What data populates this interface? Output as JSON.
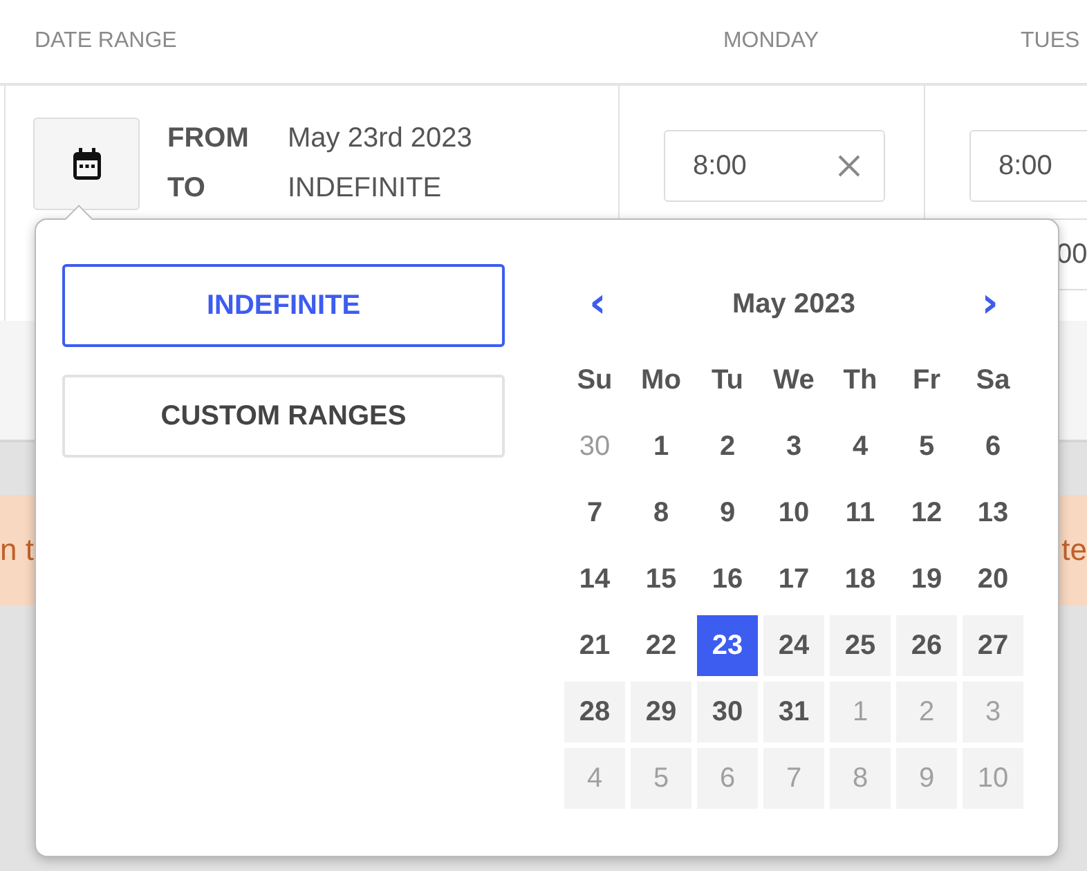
{
  "table": {
    "columns": [
      "DATE RANGE",
      "MONDAY",
      "TUES"
    ],
    "row": {
      "from_label": "FROM",
      "from_value": "May 23rd 2023",
      "to_label": "TO",
      "to_value": "INDEFINITE",
      "monday": {
        "value": "8:00"
      },
      "tuesday": {
        "value": "8:00",
        "second_value": "00"
      }
    }
  },
  "banner": {
    "left_text": "n t",
    "right_text": "te"
  },
  "date_picker": {
    "options": [
      {
        "label": "INDEFINITE",
        "selected": true
      },
      {
        "label": "CUSTOM RANGES",
        "selected": false
      }
    ],
    "prev": "‹",
    "next": "›",
    "month": "May 2023",
    "weekdays": [
      "Su",
      "Mo",
      "Tu",
      "We",
      "Th",
      "Fr",
      "Sa"
    ],
    "days": [
      {
        "label": "30",
        "muted": true,
        "in_range": false,
        "selected": false
      },
      {
        "label": "1",
        "muted": false,
        "in_range": false,
        "selected": false
      },
      {
        "label": "2",
        "muted": false,
        "in_range": false,
        "selected": false
      },
      {
        "label": "3",
        "muted": false,
        "in_range": false,
        "selected": false
      },
      {
        "label": "4",
        "muted": false,
        "in_range": false,
        "selected": false
      },
      {
        "label": "5",
        "muted": false,
        "in_range": false,
        "selected": false
      },
      {
        "label": "6",
        "muted": false,
        "in_range": false,
        "selected": false
      },
      {
        "label": "7",
        "muted": false,
        "in_range": false,
        "selected": false
      },
      {
        "label": "8",
        "muted": false,
        "in_range": false,
        "selected": false
      },
      {
        "label": "9",
        "muted": false,
        "in_range": false,
        "selected": false
      },
      {
        "label": "10",
        "muted": false,
        "in_range": false,
        "selected": false
      },
      {
        "label": "11",
        "muted": false,
        "in_range": false,
        "selected": false
      },
      {
        "label": "12",
        "muted": false,
        "in_range": false,
        "selected": false
      },
      {
        "label": "13",
        "muted": false,
        "in_range": false,
        "selected": false
      },
      {
        "label": "14",
        "muted": false,
        "in_range": false,
        "selected": false
      },
      {
        "label": "15",
        "muted": false,
        "in_range": false,
        "selected": false
      },
      {
        "label": "16",
        "muted": false,
        "in_range": false,
        "selected": false
      },
      {
        "label": "17",
        "muted": false,
        "in_range": false,
        "selected": false
      },
      {
        "label": "18",
        "muted": false,
        "in_range": false,
        "selected": false
      },
      {
        "label": "19",
        "muted": false,
        "in_range": false,
        "selected": false
      },
      {
        "label": "20",
        "muted": false,
        "in_range": false,
        "selected": false
      },
      {
        "label": "21",
        "muted": false,
        "in_range": false,
        "selected": false
      },
      {
        "label": "22",
        "muted": false,
        "in_range": false,
        "selected": false
      },
      {
        "label": "23",
        "muted": false,
        "in_range": true,
        "selected": true
      },
      {
        "label": "24",
        "muted": false,
        "in_range": true,
        "selected": false
      },
      {
        "label": "25",
        "muted": false,
        "in_range": true,
        "selected": false
      },
      {
        "label": "26",
        "muted": false,
        "in_range": true,
        "selected": false
      },
      {
        "label": "27",
        "muted": false,
        "in_range": true,
        "selected": false
      },
      {
        "label": "28",
        "muted": false,
        "in_range": true,
        "selected": false
      },
      {
        "label": "29",
        "muted": false,
        "in_range": true,
        "selected": false
      },
      {
        "label": "30",
        "muted": false,
        "in_range": true,
        "selected": false
      },
      {
        "label": "31",
        "muted": false,
        "in_range": true,
        "selected": false
      },
      {
        "label": "1",
        "muted": true,
        "in_range": true,
        "selected": false
      },
      {
        "label": "2",
        "muted": true,
        "in_range": true,
        "selected": false
      },
      {
        "label": "3",
        "muted": true,
        "in_range": true,
        "selected": false
      },
      {
        "label": "4",
        "muted": true,
        "in_range": true,
        "selected": false
      },
      {
        "label": "5",
        "muted": true,
        "in_range": true,
        "selected": false
      },
      {
        "label": "6",
        "muted": true,
        "in_range": true,
        "selected": false
      },
      {
        "label": "7",
        "muted": true,
        "in_range": true,
        "selected": false
      },
      {
        "label": "8",
        "muted": true,
        "in_range": true,
        "selected": false
      },
      {
        "label": "9",
        "muted": true,
        "in_range": true,
        "selected": false
      },
      {
        "label": "10",
        "muted": true,
        "in_range": true,
        "selected": false
      }
    ]
  }
}
